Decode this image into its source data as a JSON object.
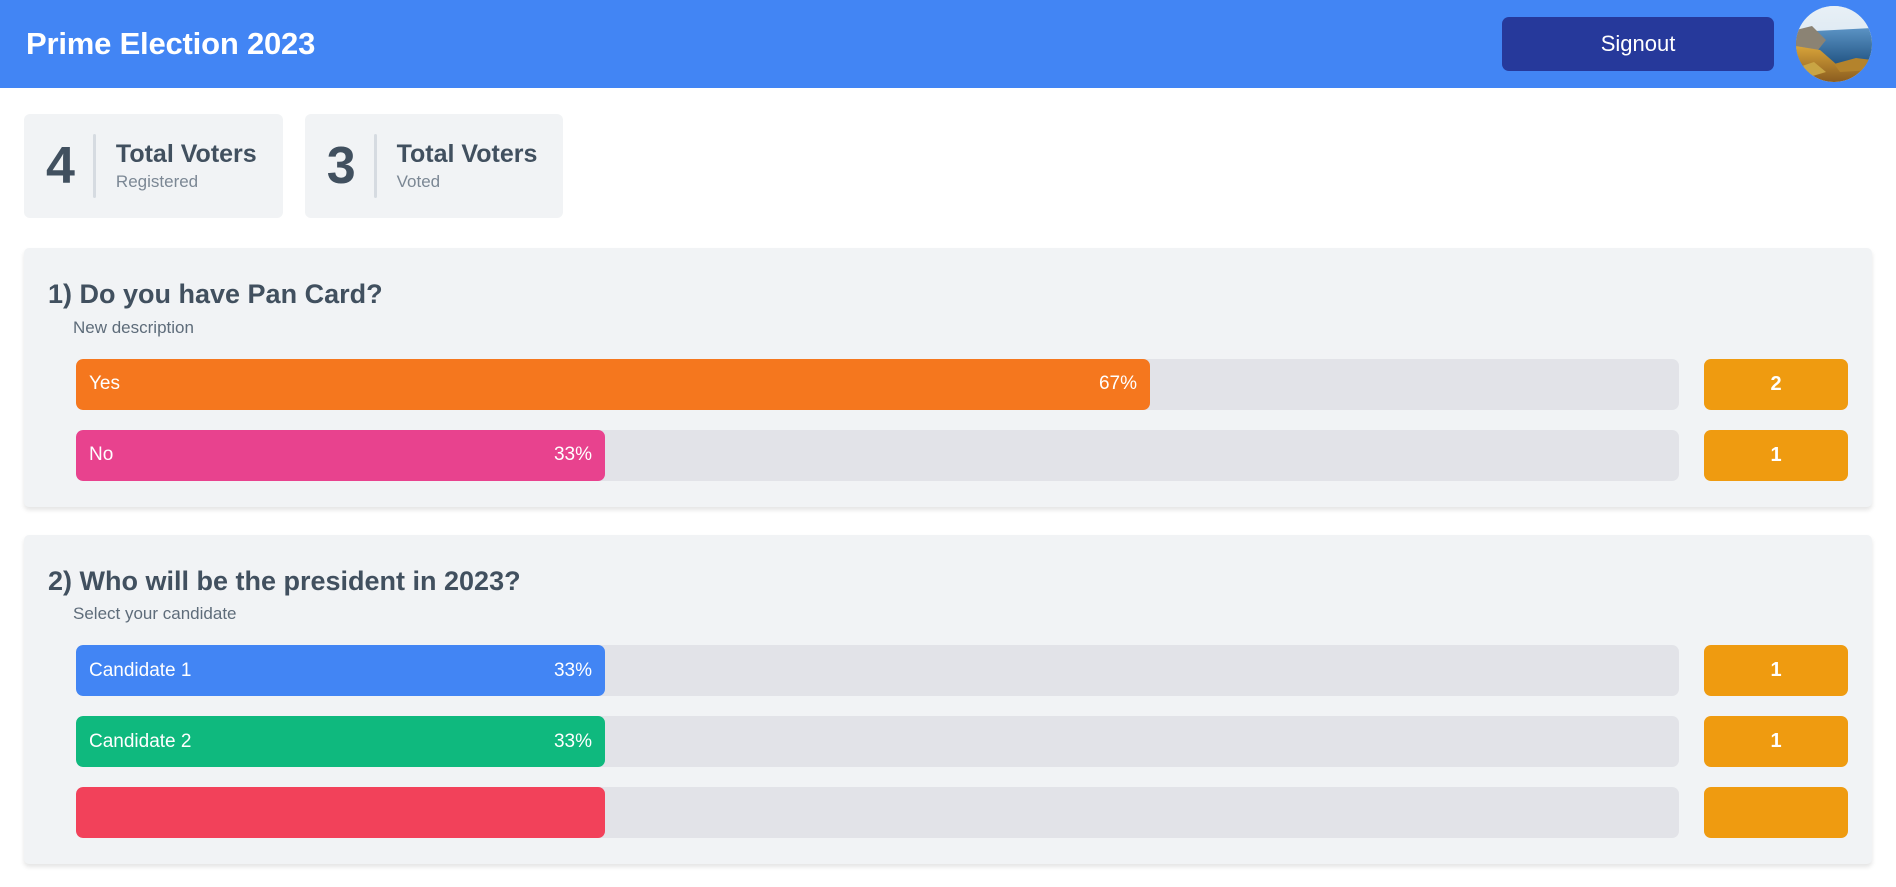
{
  "header": {
    "title": "Prime Election 2023",
    "signout_label": "Signout",
    "brand_color": "#4285f4",
    "signout_color": "#26399b",
    "avatar_name": "user-avatar-landscape-photo"
  },
  "stats": [
    {
      "number": "4",
      "label": "Total Voters",
      "sub": "Registered"
    },
    {
      "number": "3",
      "label": "Total Voters",
      "sub": "Voted"
    }
  ],
  "questions": [
    {
      "title": "1) Do you have Pan Card?",
      "description": "New description",
      "options": [
        {
          "label": "Yes",
          "percent_text": "67%",
          "percent": 67,
          "count": "2",
          "color": "#f5771e"
        },
        {
          "label": "No",
          "percent_text": "33%",
          "percent": 33,
          "count": "1",
          "color": "#e8428e"
        }
      ]
    },
    {
      "title": "2) Who will be the president in 2023?",
      "description": "Select your candidate",
      "options": [
        {
          "label": "Candidate 1",
          "percent_text": "33%",
          "percent": 33,
          "count": "1",
          "color": "#4285f4"
        },
        {
          "label": "Candidate 2",
          "percent_text": "33%",
          "percent": 33,
          "count": "1",
          "color": "#0fb97e"
        },
        {
          "label": "",
          "percent_text": "",
          "percent": 33,
          "count": "",
          "color": "#f2415a"
        }
      ]
    }
  ],
  "colors": {
    "page_background": "#ffffff",
    "card_background": "#f1f3f5",
    "bar_track": "#e2e3e8",
    "count_badge": "#ef9b10",
    "heading_text": "#41505f",
    "muted_text": "#7b8794"
  }
}
